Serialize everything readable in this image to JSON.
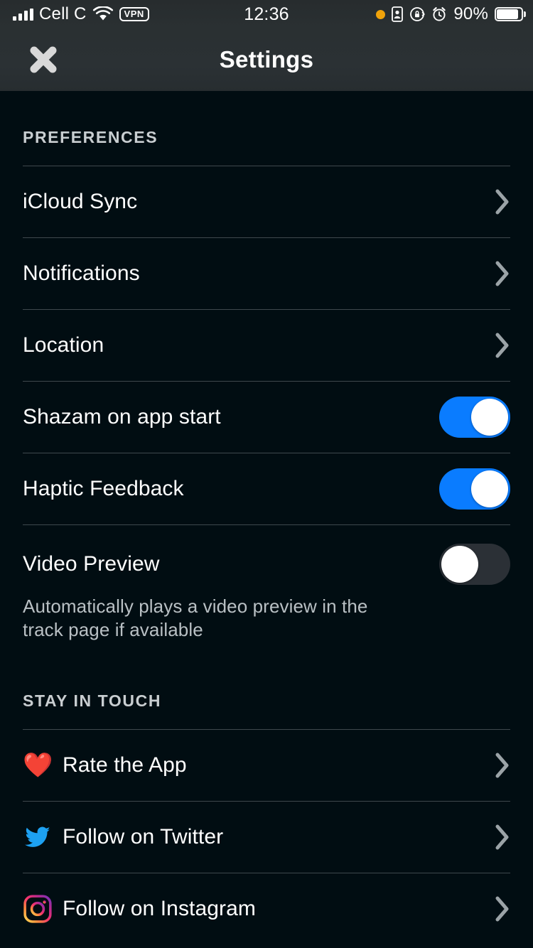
{
  "status_bar": {
    "carrier": "Cell C",
    "vpn_label": "VPN",
    "time": "12:36",
    "battery_percent": "90%",
    "icons": [
      "signal-bars-icon",
      "wifi-icon",
      "vpn-badge-icon",
      "orange-recording-dot-icon",
      "id-badge-icon",
      "rotation-lock-icon",
      "alarm-clock-icon",
      "battery-icon"
    ]
  },
  "navbar": {
    "title": "Settings",
    "close_label": "Close"
  },
  "sections": [
    {
      "title": "PREFERENCES",
      "rows": [
        {
          "label": "iCloud Sync",
          "accessory": "chevron"
        },
        {
          "label": "Notifications",
          "accessory": "chevron"
        },
        {
          "label": "Location",
          "accessory": "chevron"
        },
        {
          "label": "Shazam on app start",
          "accessory": "toggle",
          "toggle_state": "on"
        },
        {
          "label": "Haptic Feedback",
          "accessory": "toggle",
          "toggle_state": "on"
        },
        {
          "label": "Video Preview",
          "accessory": "toggle",
          "toggle_state": "off",
          "subtitle": "Automatically plays a video preview in the track page if available"
        }
      ]
    },
    {
      "title": "STAY IN TOUCH",
      "rows": [
        {
          "label": "Rate the App",
          "icon": "heart-emoji",
          "accessory": "chevron"
        },
        {
          "label": "Follow on Twitter",
          "icon": "twitter-icon",
          "accessory": "chevron"
        },
        {
          "label": "Follow on Instagram",
          "icon": "instagram-icon",
          "accessory": "chevron"
        }
      ]
    }
  ],
  "colors": {
    "background": "#010d12",
    "navbar": "#2b3134",
    "toggle_on": "#0a7cff",
    "toggle_off": "#2b3036",
    "divider": "#4a5458",
    "accent_orange": "#f0a30a",
    "twitter_blue": "#1da1f2",
    "heart_red": "#e8283c"
  }
}
